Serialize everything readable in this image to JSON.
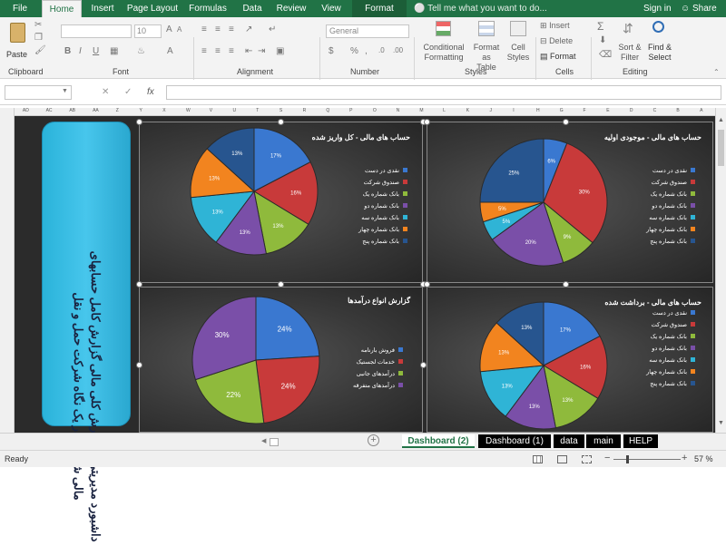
{
  "ribbon_tabs": [
    {
      "label": "File",
      "active": false
    },
    {
      "label": "Home",
      "active": true
    },
    {
      "label": "Insert",
      "active": false
    },
    {
      "label": "Page Layout",
      "active": false
    },
    {
      "label": "Formulas",
      "active": false
    },
    {
      "label": "Data",
      "active": false
    },
    {
      "label": "Review",
      "active": false
    },
    {
      "label": "View",
      "active": false
    },
    {
      "label": "Format",
      "active": false
    }
  ],
  "tell_me": "Tell me what you want to do...",
  "sign_in": "Sign in",
  "share": "Share",
  "ribbon": {
    "clipboard": {
      "paste": "Paste",
      "label": "Clipboard"
    },
    "font": {
      "size": "10",
      "label": "Font"
    },
    "alignment": {
      "label": "Alignment"
    },
    "number": {
      "format": "General",
      "label": "Number"
    },
    "styles": {
      "conditional": "Conditional\nFormatting",
      "format_table": "Format as\nTable",
      "cell_styles": "Cell\nStyles",
      "label": "Styles"
    },
    "cells": {
      "insert": "Insert",
      "delete": "Delete",
      "format": "Format",
      "label": "Cells"
    },
    "editing": {
      "sort": "Sort &\nFilter",
      "find": "Find &\nSelect",
      "label": "Editing"
    }
  },
  "formula_bar": {
    "fx": "fx",
    "name_box": "",
    "content": ""
  },
  "columns": [
    "AD",
    "AC",
    "AB",
    "AA",
    "Z",
    "Y",
    "X",
    "W",
    "V",
    "U",
    "T",
    "S",
    "R",
    "Q",
    "P",
    "O",
    "N",
    "M",
    "L",
    "K",
    "J",
    "I",
    "H",
    "G",
    "F",
    "E",
    "D",
    "C",
    "B",
    "A"
  ],
  "banner_text": "داشبورد مدیریتی و گزارش کلی مالی گزارش کامل حسابهای مالی شرکت در یک نگاه شرکت حمل و نقل",
  "charts": [
    {
      "id": "chart-kol-variz",
      "title": "حساب های مالی - کل واریز شده",
      "labels": [
        "17%",
        "16%",
        "13%",
        "13%",
        "13%",
        "13%",
        "13%"
      ],
      "values": [
        17,
        16,
        13,
        13,
        13,
        13,
        13
      ],
      "colors": [
        "#3a78d0",
        "#c83a3a",
        "#8fba3c",
        "#7a4fa8",
        "#2fb4d6",
        "#f2841f",
        "#27558f"
      ],
      "legend": [
        "نقدی در دست",
        "صندوق شرکت",
        "بانک شماره یک",
        "بانک شماره دو",
        "بانک شماره سه",
        "بانک شماره چهار",
        "بانک شماره پنج"
      ]
    },
    {
      "id": "chart-mojodi",
      "title": "حساب های مالی - موجودی اولیه",
      "labels": [
        "6%",
        "30%",
        "9%",
        "20%",
        "5%",
        "5%",
        "25%"
      ],
      "values": [
        6,
        30,
        9,
        20,
        5,
        5,
        25
      ],
      "colors": [
        "#3a78d0",
        "#c83a3a",
        "#8fba3c",
        "#7a4fa8",
        "#2fb4d6",
        "#f2841f",
        "#27558f"
      ],
      "legend": [
        "نقدی در دست",
        "صندوق شرکت",
        "بانک شماره یک",
        "بانک شماره دو",
        "بانک شماره سه",
        "بانک شماره چهار",
        "بانک شماره پنج"
      ]
    },
    {
      "id": "chart-daramad",
      "title": "گزارش انواع درآمدها",
      "labels": [
        "24%",
        "24%",
        "22%",
        "30%"
      ],
      "values": [
        24,
        24,
        22,
        30
      ],
      "colors": [
        "#3a78d0",
        "#c83a3a",
        "#8fba3c",
        "#7a4fa8"
      ],
      "legend": [
        "فروش بارنامه",
        "خدمات لجستیک",
        "درآمدهای جانبی",
        "درآمدهای متفرقه"
      ]
    },
    {
      "id": "chart-bardasht",
      "title": "حساب های مالی - برداشت شده",
      "labels": [
        "17%",
        "16%",
        "13%",
        "13%",
        "13%",
        "13%",
        "13%"
      ],
      "values": [
        17,
        16,
        13,
        13,
        13,
        13,
        13
      ],
      "colors": [
        "#3a78d0",
        "#c83a3a",
        "#8fba3c",
        "#7a4fa8",
        "#2fb4d6",
        "#f2841f",
        "#27558f"
      ],
      "legend": [
        "نقدی در دست",
        "صندوق شرکت",
        "بانک شماره یک",
        "بانک شماره دو",
        "بانک شماره سه",
        "بانک شماره چهار",
        "بانک شماره پنج"
      ]
    }
  ],
  "chart_data": [
    {
      "type": "pie",
      "title": "حساب های مالی - کل واریز شده",
      "categories": [
        "نقدی در دست",
        "صندوق شرکت",
        "بانک شماره یک",
        "بانک شماره دو",
        "بانک شماره سه",
        "بانک شماره چهار",
        "بانک شماره پنج"
      ],
      "values": [
        17,
        16,
        13,
        13,
        13,
        13,
        13
      ],
      "legend": "right"
    },
    {
      "type": "pie",
      "title": "حساب های مالی - موجودی اولیه",
      "categories": [
        "نقدی در دست",
        "صندوق شرکت",
        "بانک شماره یک",
        "بانک شماره دو",
        "بانک شماره سه",
        "بانک شماره چهار",
        "بانک شماره پنج"
      ],
      "values": [
        6,
        30,
        9,
        20,
        5,
        5,
        25
      ],
      "legend": "right"
    },
    {
      "type": "pie",
      "title": "گزارش انواع درآمدها",
      "categories": [
        "فروش بارنامه",
        "خدمات لجستیک",
        "درآمدهای جانبی",
        "درآمدهای متفرقه"
      ],
      "values": [
        24,
        24,
        22,
        30
      ],
      "legend": "right"
    },
    {
      "type": "pie",
      "title": "حساب های مالی - برداشت شده",
      "categories": [
        "نقدی در دست",
        "صندوق شرکت",
        "بانک شماره یک",
        "بانک شماره دو",
        "بانک شماره سه",
        "بانک شماره چهار",
        "بانک شماره پنج"
      ],
      "values": [
        17,
        16,
        13,
        13,
        13,
        13,
        13
      ],
      "legend": "right"
    }
  ],
  "sheet_tabs": [
    {
      "label": "Dashboard (2)",
      "active": true
    },
    {
      "label": "Dashboard (1)",
      "active": false
    },
    {
      "label": "data",
      "active": false
    },
    {
      "label": "main",
      "active": false
    },
    {
      "label": "HELP",
      "active": false
    }
  ],
  "status": {
    "ready": "Ready",
    "zoom": "57 %",
    "add_sheet": "+"
  }
}
